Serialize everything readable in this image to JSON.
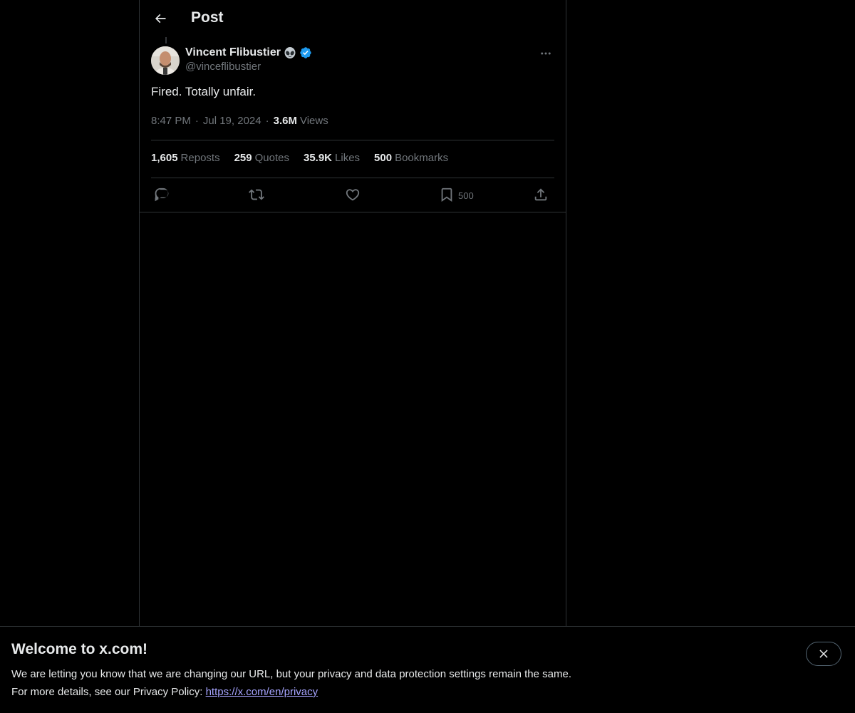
{
  "header": {
    "title": "Post",
    "back_icon": "arrow-left-icon"
  },
  "post": {
    "author": {
      "name": "Vincent Flibustier",
      "handle": "@vinceflibustier",
      "emoji_badge": "👽",
      "verified": true
    },
    "text": "Fired. Totally unfair.",
    "meta": {
      "time": "8:47 PM",
      "separator": "·",
      "date": "Jul 19, 2024",
      "views_count": "3.6M",
      "views_label": "Views"
    },
    "stats": [
      {
        "value": "1,605",
        "label": "Reposts"
      },
      {
        "value": "259",
        "label": "Quotes"
      },
      {
        "value": "35.9K",
        "label": "Likes"
      },
      {
        "value": "500",
        "label": "Bookmarks"
      }
    ],
    "actions": {
      "reply_icon": "reply-icon",
      "repost_icon": "repost-icon",
      "like_icon": "heart-icon",
      "bookmark_icon": "bookmark-icon",
      "bookmark_count": "500",
      "share_icon": "share-icon"
    }
  },
  "banner": {
    "title": "Welcome to x.com!",
    "line1": "We are letting you know that we are changing our URL, but your privacy and data protection settings remain the same.",
    "line2_prefix": "For more details, see our Privacy Policy: ",
    "link_text": "https://x.com/en/privacy",
    "close_icon": "close-icon"
  },
  "colors": {
    "background": "#000000",
    "text_primary": "#e7e9ea",
    "text_secondary": "#71767b",
    "border": "#2f3336",
    "verified_blue": "#1d9bf0",
    "link": "#a6a4ff"
  }
}
